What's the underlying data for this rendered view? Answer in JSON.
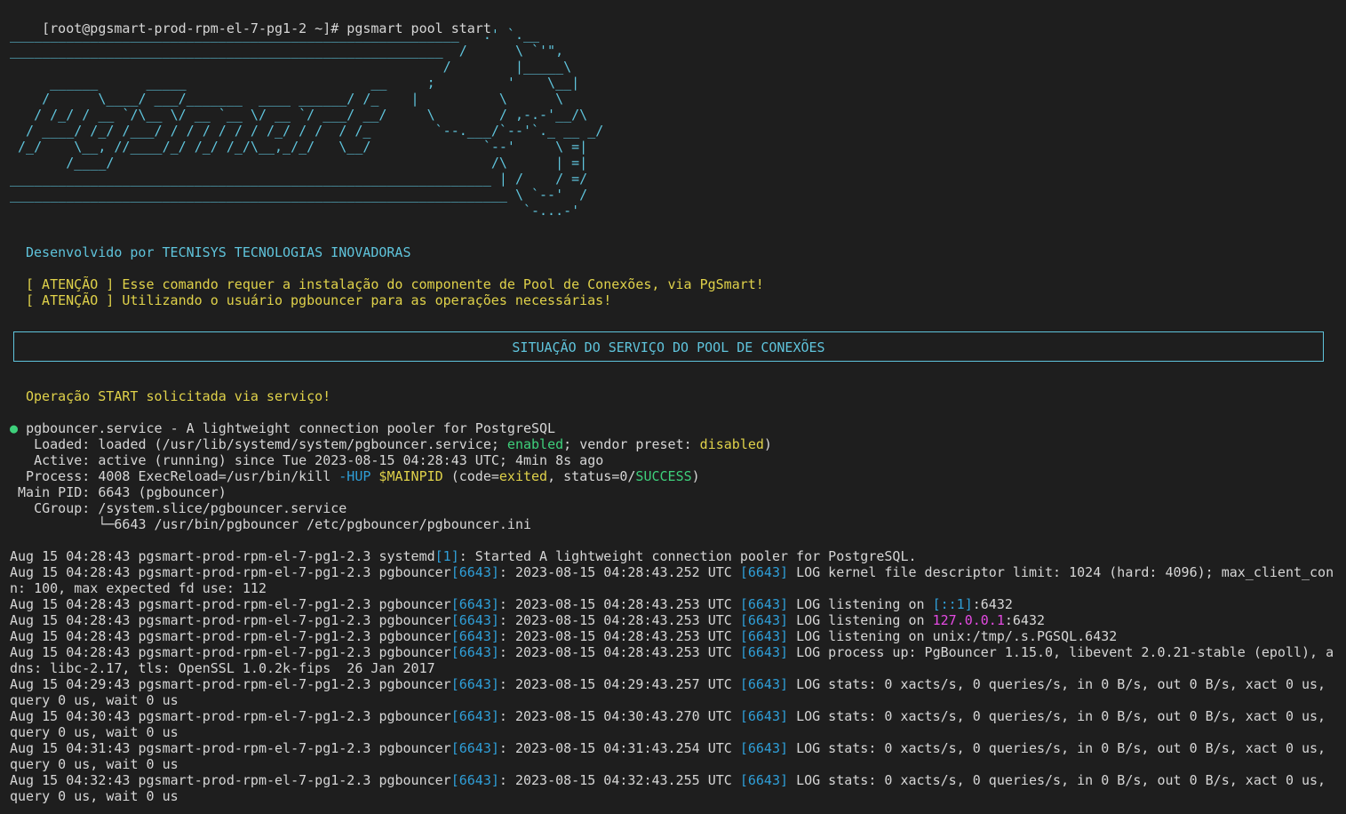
{
  "window": {
    "title": "root@pgsmart-prod-rpm-el-7-pg1-2",
    "colors": {
      "background": "#1e1e1e",
      "text": "#d6d6d6",
      "cyan": "#5fc4dc",
      "yellow": "#e0d24a",
      "green": "#3ed07b",
      "blue": "#2f9fd8",
      "magenta": "#e44ae2"
    }
  },
  "prompt": {
    "text": "[root@pgsmart-prod-rpm-el-7-pg1-2 ~]# pgsmart pool start"
  },
  "banner": {
    "art": "________________________________________________________   .' `.__\n______________________________________________________  /      \\ `'\",\n                                                      /        |_____\\\n     ______      _____                       __     ;         '    \\__|\n    /      \\____/ ___/_______  ____ ______/ /_    |          \\      \\\n   / /_/ / __ `/\\__ \\/ __ `__ \\/ __ `/ ___/ __/     \\        / ,-.-'__/\\\n  / ____/ /_/ /___/ / / / / / / /_/ / /  / /_        `--.___/`--'`._ __ _/\n /_/    \\__, //____/_/ /_/ /_/\\__,_/_/   \\__/              `--'     \\ =|\n       /____/                                               /\\      | =|\n____________________________________________________________ | /    / =/\n______________________________________________________________ \\ `--'  /\n                                                                `-...-'",
    "developer": "Desenvolvido por TECNISYS TECNOLOGIAS INOVADORAS",
    "warnings": [
      "[ ATENÇÃO ] Esse comando requer a instalação do componente de Pool de Conexões, via PgSmart!",
      "[ ATENÇÃO ] Utilizando o usuário pgbouncer para as operações necessárias!"
    ],
    "status_box_title": "SITUAÇÃO DO SERVIÇO DO POOL DE CONEXÕES",
    "operation_message": "Operação START solicitada via serviço!"
  },
  "service": {
    "bullet": "●",
    "name_line": "pgbouncer.service - A lightweight connection pooler for PostgreSQL",
    "loaded_prefix": "   Loaded: loaded (/usr/lib/systemd/system/pgbouncer.service; ",
    "loaded_enabled": "enabled",
    "loaded_mid": "; vendor preset: ",
    "loaded_disabled": "disabled",
    "loaded_suffix": ")",
    "active": "   Active: active (running) since Tue 2023-08-15 04:28:43 UTC; 4min 8s ago",
    "process_prefix": "  Process: 4008 ExecReload=/usr/bin/kill ",
    "process_hup": "-HUP",
    "process_mainpid": "$MAINPID",
    "process_mid1": " (code=",
    "process_exited": "exited",
    "process_mid2": ", status=0/",
    "process_success": "SUCCESS",
    "process_suffix": ")",
    "main_pid": " Main PID: 6643 (pgbouncer)",
    "cgroup": "   CGroup: /system.slice/pgbouncer.service",
    "cgroup_child": "           └─6643 /usr/bin/pgbouncer /etc/pgbouncer/pgbouncer.ini"
  },
  "logs": {
    "prefix": "Aug 15 ",
    "host": "pgsmart-prod-rpm-el-7-pg1-2.3",
    "systemd_line": {
      "time": "04:28:43",
      "proc": "systemd",
      "pid": "[1]",
      "message": ": Started A lightweight connection pooler for PostgreSQL."
    },
    "proc": "pgbouncer",
    "pid": "[6643]",
    "inner_pid": "[6643]",
    "entries": [
      {
        "time": "04:28:43",
        "stamp": "2023-08-15 04:28:43.252 UTC",
        "msg": "LOG kernel file descriptor limit: 1024 (hard: 4096); max_client_con",
        "cont": "n: 100, max expected fd use: 112"
      },
      {
        "time": "04:28:43",
        "stamp": "2023-08-15 04:28:43.253 UTC",
        "msg_pre": "LOG listening on ",
        "msg_hl": "[::1]",
        "msg_post": ":6432"
      },
      {
        "time": "04:28:43",
        "stamp": "2023-08-15 04:28:43.253 UTC",
        "msg_pre": "LOG listening on ",
        "msg_hl": "127.0.0.1",
        "msg_post": ":6432"
      },
      {
        "time": "04:28:43",
        "stamp": "2023-08-15 04:28:43.253 UTC",
        "msg": "LOG listening on unix:/tmp/.s.PGSQL.6432"
      },
      {
        "time": "04:28:43",
        "stamp": "2023-08-15 04:28:43.253 UTC",
        "msg": "LOG process up: PgBouncer 1.15.0, libevent 2.0.21-stable (epoll), a",
        "cont": "dns: libc-2.17, tls: OpenSSL 1.0.2k-fips  26 Jan 2017"
      },
      {
        "time": "04:29:43",
        "stamp": "2023-08-15 04:29:43.257 UTC",
        "msg": "LOG stats: 0 xacts/s, 0 queries/s, in 0 B/s, out 0 B/s, xact 0 us,",
        "cont": "query 0 us, wait 0 us"
      },
      {
        "time": "04:30:43",
        "stamp": "2023-08-15 04:30:43.270 UTC",
        "msg": "LOG stats: 0 xacts/s, 0 queries/s, in 0 B/s, out 0 B/s, xact 0 us,",
        "cont": "query 0 us, wait 0 us"
      },
      {
        "time": "04:31:43",
        "stamp": "2023-08-15 04:31:43.254 UTC",
        "msg": "LOG stats: 0 xacts/s, 0 queries/s, in 0 B/s, out 0 B/s, xact 0 us,",
        "cont": "query 0 us, wait 0 us"
      },
      {
        "time": "04:32:43",
        "stamp": "2023-08-15 04:32:43.255 UTC",
        "msg": "LOG stats: 0 xacts/s, 0 queries/s, in 0 B/s, out 0 B/s, xact 0 us,",
        "cont": "query 0 us, wait 0 us"
      }
    ]
  }
}
